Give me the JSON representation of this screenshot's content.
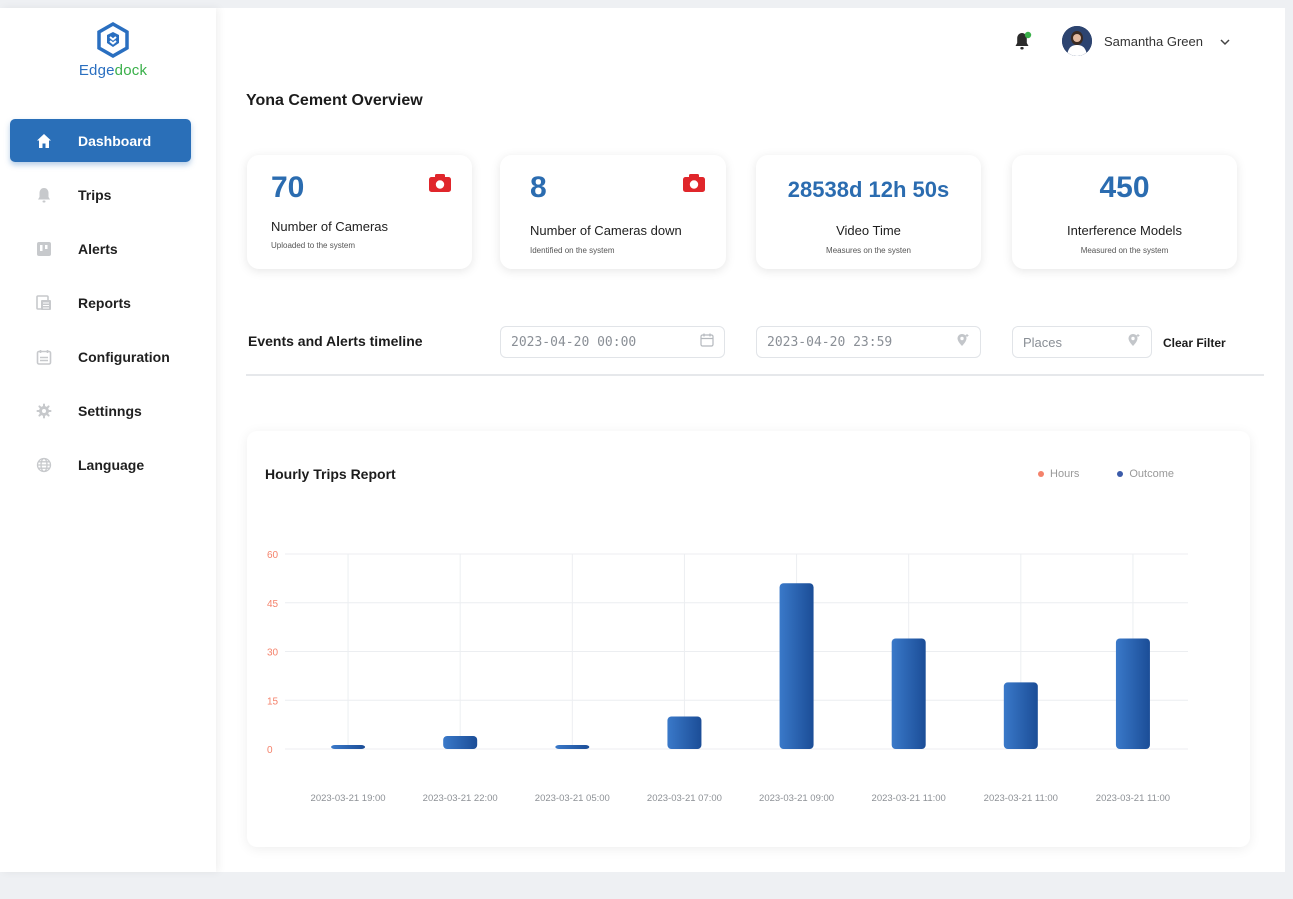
{
  "brand": {
    "name_part1": "Edge",
    "name_part2": "dock"
  },
  "sidebar": {
    "items": [
      {
        "label": "Dashboard",
        "icon": "home-icon",
        "active": true
      },
      {
        "label": "Trips",
        "icon": "bell-icon",
        "active": false
      },
      {
        "label": "Alerts",
        "icon": "board-icon",
        "active": false
      },
      {
        "label": "Reports",
        "icon": "report-icon",
        "active": false
      },
      {
        "label": "Configuration",
        "icon": "calendar-icon",
        "active": false
      },
      {
        "label": "Settinngs",
        "icon": "gear-icon",
        "active": false
      },
      {
        "label": "Language",
        "icon": "globe-icon",
        "active": false
      }
    ]
  },
  "header": {
    "user_name": "Samantha Green"
  },
  "page": {
    "title": "Yona Cement Overview"
  },
  "stats": [
    {
      "value": "70",
      "label": "Number of Cameras",
      "sub": "Uploaded to the system"
    },
    {
      "value": "8",
      "label": "Number of Cameras down",
      "sub": "Identified on the system"
    },
    {
      "value": "28538d 12h 50s",
      "label": "Video Time",
      "sub": "Measures on the systen"
    },
    {
      "value": "450",
      "label": "Interference Models",
      "sub": "Measured on the system"
    }
  ],
  "filters": {
    "title": "Events and Alerts timeline",
    "start": "2023-04-20 00:00",
    "end": "2023-04-20 23:59",
    "places": "Places",
    "clear": "Clear Filter"
  },
  "colors": {
    "accent": "#2b6cb0",
    "camera_icon": "#e0262b",
    "hours_dot": "#f4826b",
    "outcome_dot": "#3b5ba9",
    "logo_green": "#3ab04a"
  },
  "chart_data": {
    "type": "bar",
    "title": "Hourly Trips Report",
    "legend": [
      "Hours",
      "Outcome"
    ],
    "legend_position": "top-right",
    "categories": [
      "2023-03-21 19:00",
      "2023-03-21 22:00",
      "2023-03-21 05:00",
      "2023-03-21 07:00",
      "2023-03-21 09:00",
      "2023-03-21 11:00",
      "2023-03-21 11:00",
      "2023-03-21 11:00"
    ],
    "values": [
      1,
      4,
      1,
      10,
      51,
      34,
      20.5,
      34
    ],
    "ylim": [
      0,
      60
    ],
    "yticks": [
      0,
      15,
      30,
      45,
      60
    ],
    "grid": true
  }
}
